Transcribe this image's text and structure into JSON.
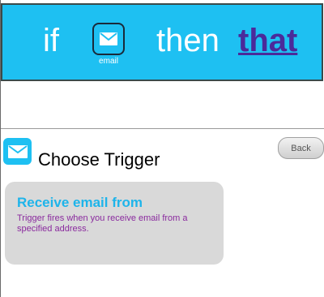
{
  "banner": {
    "if_text": "if",
    "channel": {
      "label": "email",
      "icon": "envelope-icon"
    },
    "then_text": "then",
    "that_text": "that",
    "colors": {
      "background": "#1ec0f2",
      "that": "#4b2a9a"
    }
  },
  "trigger_section": {
    "icon": "envelope-icon",
    "title": "Choose Trigger",
    "back_label": "Back"
  },
  "triggers": [
    {
      "title": "Receive email from",
      "description": "Trigger fires when you receive email from a specified address."
    }
  ]
}
